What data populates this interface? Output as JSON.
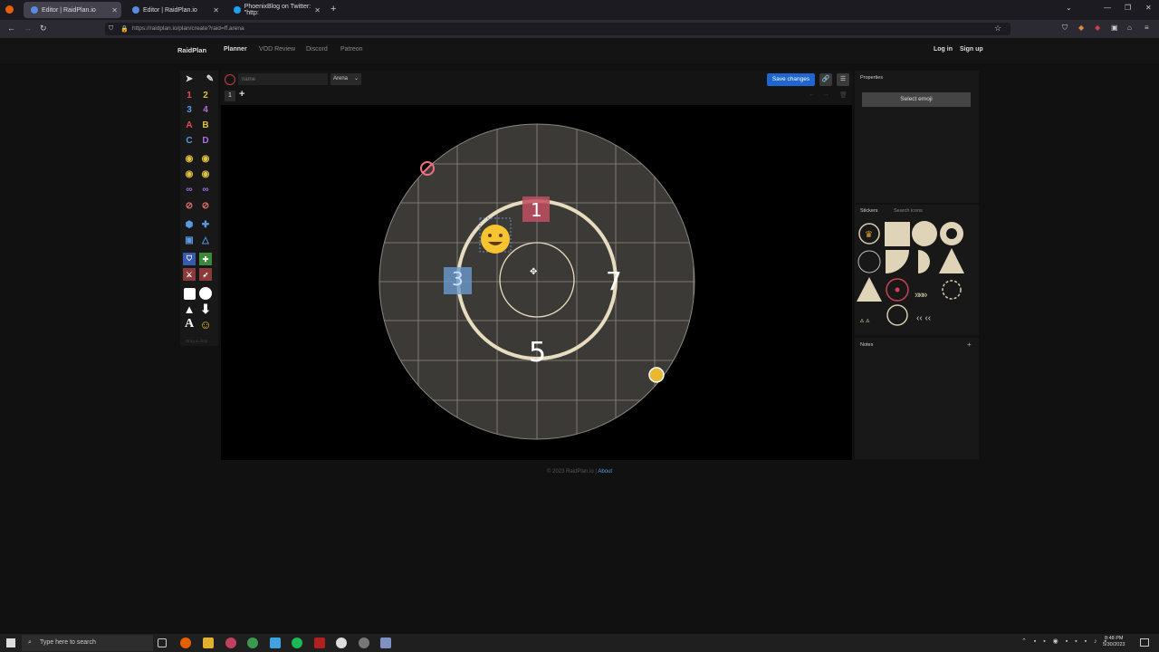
{
  "browser": {
    "tabs": [
      {
        "title": "Editor | RaidPlan.io",
        "active": true
      },
      {
        "title": "Editor | RaidPlan.io",
        "active": false
      },
      {
        "title": "PhoenixBlog on Twitter: \"http:",
        "active": false
      }
    ],
    "new_tab": "+",
    "url": "https://raidplan.io/plan/create?raid=ff.arena"
  },
  "site": {
    "logo": "RaidPlan",
    "nav": [
      "Planner",
      "VOD Review",
      "Discord",
      "Patreon"
    ],
    "login": "Log in",
    "signup": "Sign up"
  },
  "editor": {
    "name_placeholder": "name",
    "arena": "Arena",
    "save_label": "Save changes",
    "step_label": "1",
    "add_step": "+",
    "drag_drop": "Drag & drop"
  },
  "canvas_labels": {
    "marker_1": "1",
    "marker_3": "3",
    "marker_5": "5",
    "marker_7": "7"
  },
  "properties": {
    "title": "Properties",
    "select_emoji": "Select emoji"
  },
  "stickers": {
    "tab_stickers": "Stickers",
    "tab_search": "Search icons"
  },
  "notes": {
    "title": "Notes",
    "add": "+"
  },
  "footer": {
    "copyright": "© 2023 RaidPlan.io | ",
    "about": "About"
  },
  "taskbar": {
    "search_placeholder": "Type here to search",
    "time": "8:48 PM",
    "date": "5/30/2023"
  },
  "colors": {
    "accent": "#1f66d1",
    "ring": "#e8dcc0",
    "arena": "#3c3a36"
  }
}
